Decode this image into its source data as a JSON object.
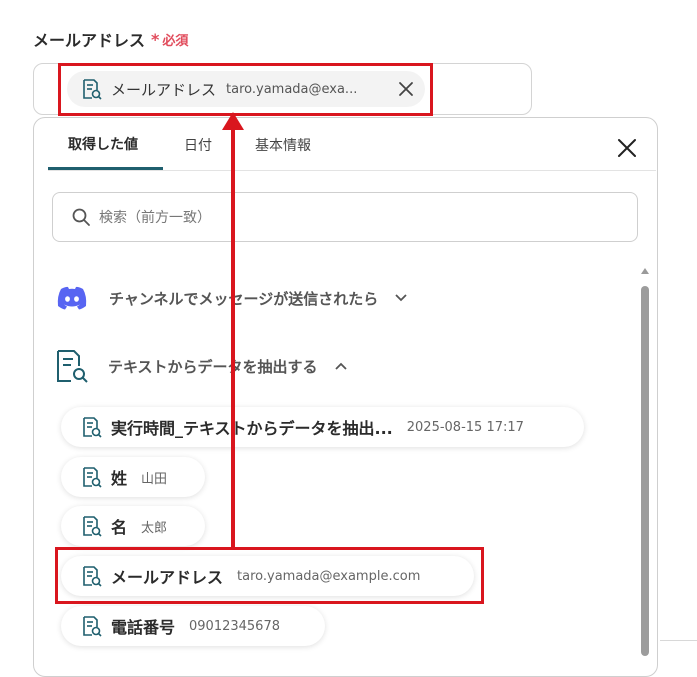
{
  "field": {
    "label": "メールアドレス",
    "required_mark": "*",
    "required_text": "必須"
  },
  "selected_chip": {
    "label": "メールアドレス",
    "value": "taro.yamada@exa..."
  },
  "tabs": [
    {
      "label": "取得した値",
      "active": true
    },
    {
      "label": "日付",
      "active": false
    },
    {
      "label": "基本情報",
      "active": false
    }
  ],
  "search": {
    "placeholder": "検索（前方一致）"
  },
  "sections": [
    {
      "label": "チャンネルでメッセージが送信されたら",
      "expanded": false,
      "icon": "discord-icon"
    },
    {
      "label": "テキストからデータを抽出する",
      "expanded": true,
      "icon": "document-search-icon"
    }
  ],
  "items": [
    {
      "label": "実行時間_テキストからデータを抽出...",
      "value": "2025-08-15 17:17"
    },
    {
      "label": "姓",
      "value": "山田"
    },
    {
      "label": "名",
      "value": "太郎"
    },
    {
      "label": "メールアドレス",
      "value": "taro.yamada@example.com"
    },
    {
      "label": "電話番号",
      "value": "09012345678"
    }
  ],
  "colors": {
    "highlight": "#d9161e",
    "accent": "#1f5f6e",
    "required": "#e14c5c",
    "discord": "#5865f2"
  }
}
